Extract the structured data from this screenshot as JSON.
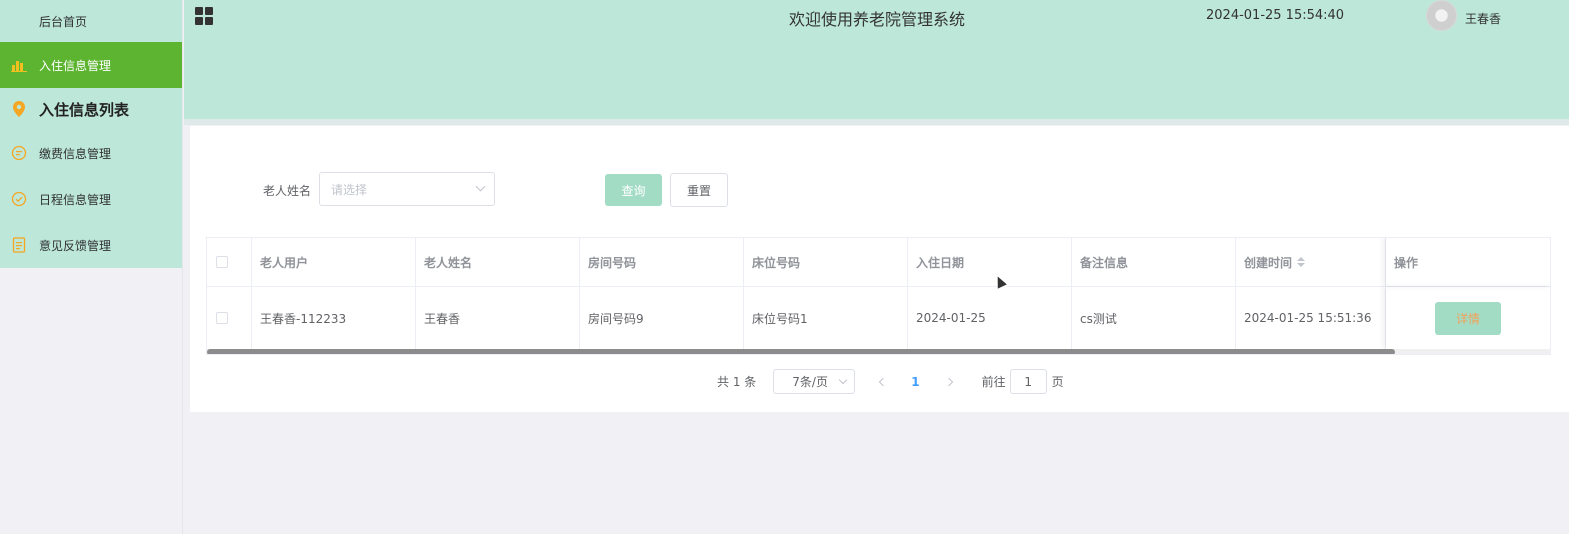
{
  "sidebar": {
    "items": [
      {
        "label": "后台首页",
        "icon": "home-icon"
      },
      {
        "label": "入住信息管理",
        "icon": "bar-chart-icon"
      },
      {
        "label": "入住信息列表",
        "icon": "location-pin-icon"
      },
      {
        "label": "缴费信息管理",
        "icon": "chat-bubble-icon"
      },
      {
        "label": "日程信息管理",
        "icon": "check-circle-icon"
      },
      {
        "label": "意见反馈管理",
        "icon": "document-icon"
      }
    ]
  },
  "header": {
    "title": "欢迎使用养老院管理系统",
    "datetime": "2024-01-25 15:54:40",
    "username": "王春香"
  },
  "search": {
    "label": "老人姓名",
    "placeholder": "请选择",
    "query_label": "查询",
    "reset_label": "重置"
  },
  "table": {
    "columns": [
      "老人用户",
      "老人姓名",
      "房间号码",
      "床位号码",
      "入住日期",
      "备注信息",
      "创建时间",
      "操作"
    ],
    "rows": [
      {
        "user": "王春香-112233",
        "name": "王春香",
        "room": "房间号码9",
        "bed": "床位号码1",
        "checkin_date": "2024-01-25",
        "remark": "cs测试",
        "created": "2024-01-25 15:51:36",
        "action": "详情"
      }
    ]
  },
  "pagination": {
    "total": "共 1 条",
    "page_size": "7条/页",
    "current_page": "1",
    "goto_label": "前往",
    "goto_value": "1",
    "page_word": "页"
  },
  "colors": {
    "header_bg": "#bde7d8",
    "sidebar_active": "#5db431",
    "button_primary": "#a3dcc5",
    "page_bg": "#f0f0f5"
  }
}
